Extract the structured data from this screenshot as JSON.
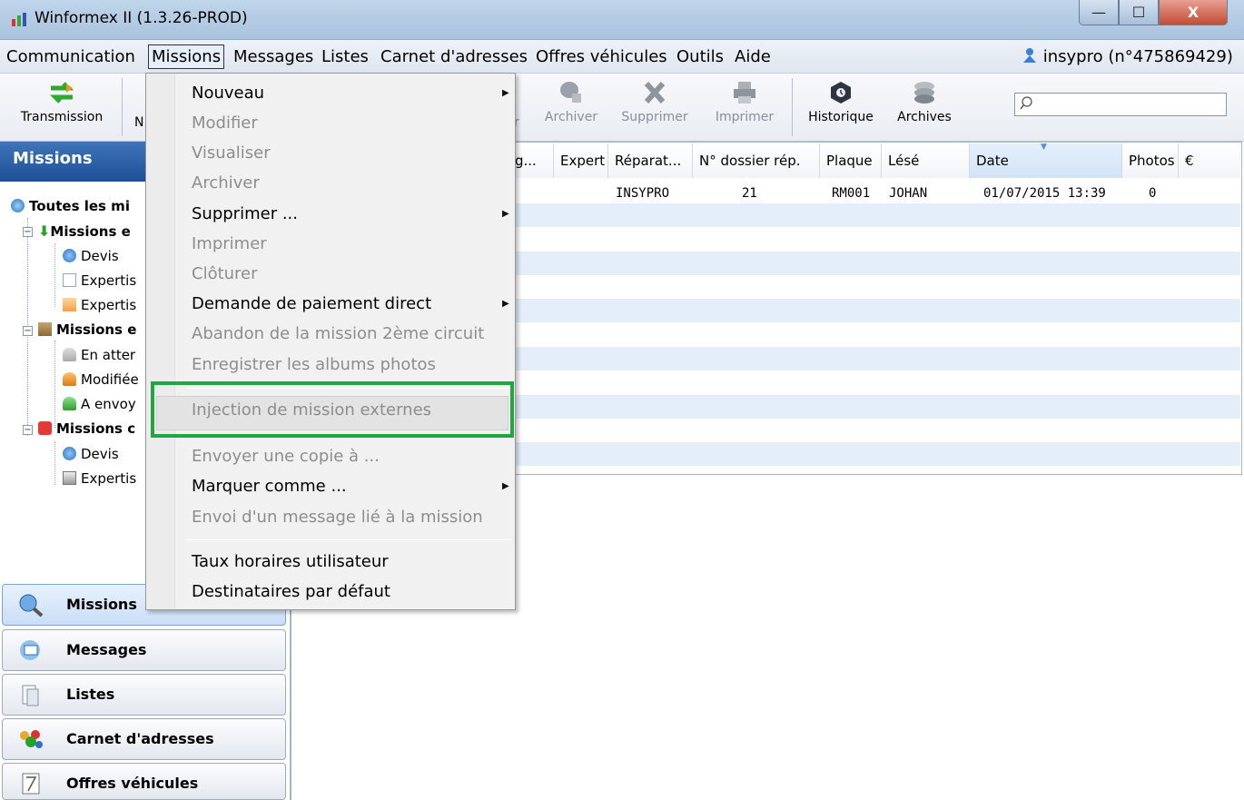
{
  "window": {
    "title": "Winformex II (1.3.26-PROD)",
    "min_glyph": "—",
    "max_glyph": "☐",
    "close_glyph": "X"
  },
  "menubar": {
    "items": [
      "Communication",
      "Missions",
      "Messages",
      "Listes",
      "Carnet d'adresses",
      "Offres véhicules",
      "Outils",
      "Aide"
    ],
    "user": "insypro (n°475869429)"
  },
  "toolbar": {
    "transmission": "Transmission",
    "partial_n": "N",
    "partial_r": "r",
    "archiver": "Archiver",
    "supprimer": "Supprimer",
    "imprimer": "Imprimer",
    "historique": "Historique",
    "archives": "Archives",
    "search_value": ""
  },
  "left_panel": {
    "header": "Missions",
    "tree": {
      "root": "Toutes les mi",
      "group1": "Missions e",
      "g1_items": [
        "Devis",
        "Expertis",
        "Expertis"
      ],
      "group2": "Missions e",
      "g2_items": [
        "En atter",
        "Modifiée",
        "A envoy"
      ],
      "group3": "Missions c",
      "g3_items": [
        "Devis",
        "Expertis"
      ]
    },
    "nav": [
      "Missions",
      "Messages",
      "Listes",
      "Carnet d'adresses",
      "Offres véhicules"
    ]
  },
  "grid": {
    "columns": [
      "g...",
      "Expert",
      "Réparat...",
      "N° dossier rép.",
      "Plaque",
      "Lésé",
      "Date",
      "Photos",
      "€"
    ],
    "rows": [
      {
        "reparateur": "INSYPRO",
        "dossier": "21",
        "plaque": "RM001",
        "lese": "JOHAN",
        "date": "01/07/2015 13:39",
        "photos": "0"
      }
    ]
  },
  "dropdown": {
    "nouveau": "Nouveau",
    "modifier": "Modifier",
    "visualiser": "Visualiser",
    "archiver": "Archiver",
    "supprimer": "Supprimer ...",
    "imprimer": "Imprimer",
    "cloturer": "Clôturer",
    "paiement": "Demande de paiement direct",
    "abandon": "Abandon de la mission 2ème circuit",
    "albums": "Enregistrer les albums photos",
    "injection": "Injection de mission externes",
    "copie": "Envoyer une copie à ...",
    "marquer": "Marquer comme ...",
    "envoi_message": "Envoi d'un message lié à la mission",
    "taux": "Taux horaires utilisateur",
    "destinataires": "Destinataires par défaut"
  },
  "colors": {
    "highlight": "#24a443",
    "header_blue": "#1e4f96",
    "row_alt": "#e4eef9"
  }
}
